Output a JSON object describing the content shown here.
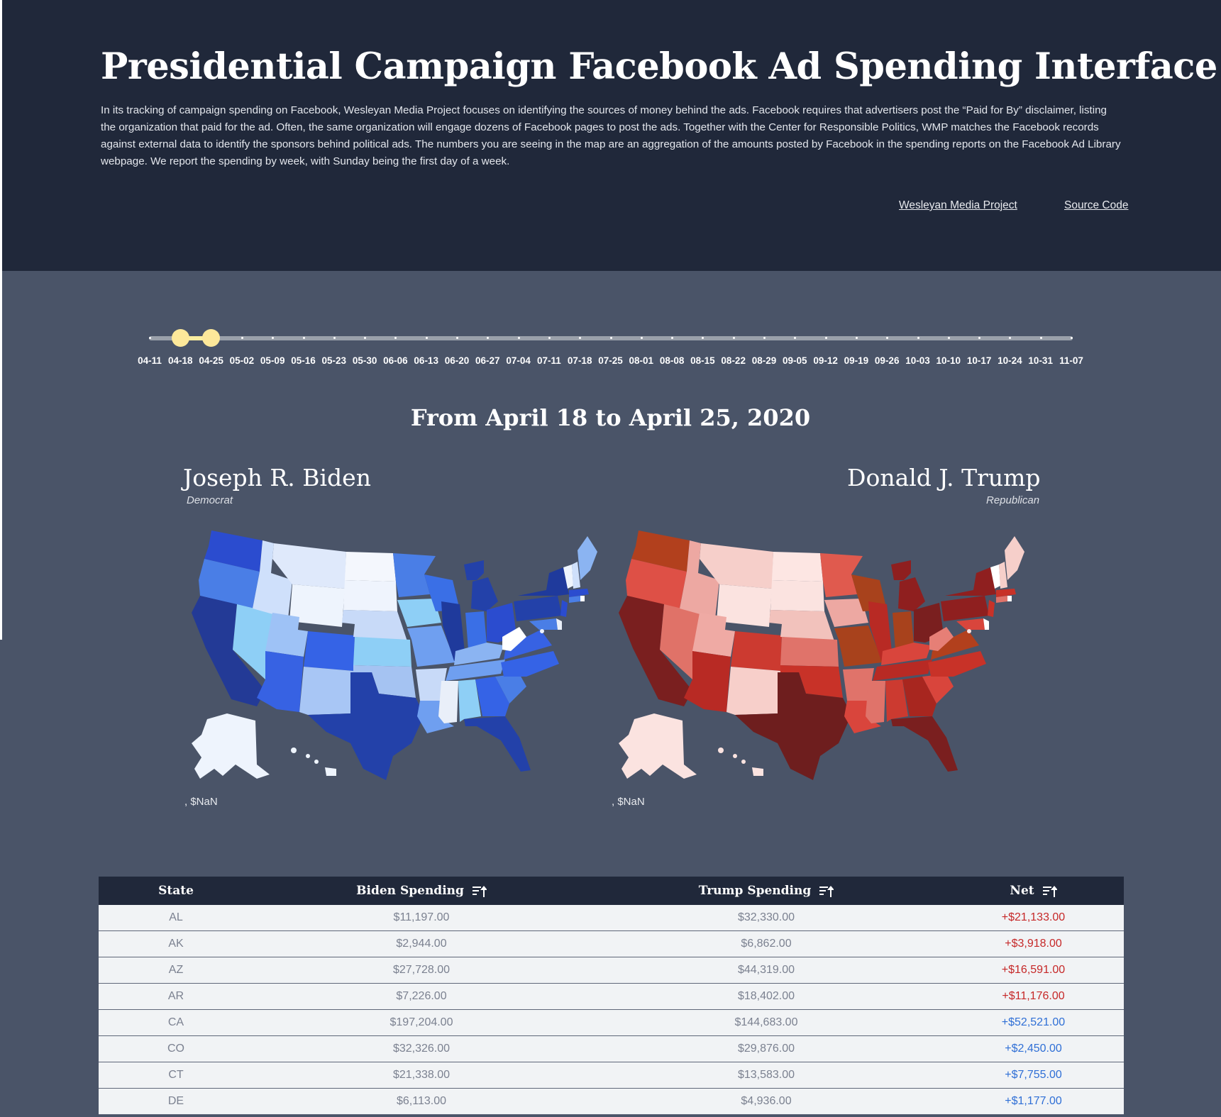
{
  "header": {
    "title": "Presidential Campaign Facebook Ad Spending Interface",
    "description": "In its tracking of campaign spending on Facebook, Wesleyan Media Project focuses on identifying the sources of money behind the ads. Facebook requires that advertisers post the “Paid for By” disclaimer, listing the organization that paid for the ad. Often, the same organization will engage dozens of Facebook pages to post the ads. Together with the Center for Responsible Politics, WMP matches the Facebook records against external data to identify the sponsors behind political ads. The numbers you are seeing in the map are an aggregation of the amounts posted by Facebook in the spending reports on the Facebook Ad Library webpage. We report the spending by week, with Sunday being the first day of a week.",
    "links": [
      "Wesleyan Media Project",
      "Source Code"
    ]
  },
  "slider": {
    "ticks": [
      "04-11",
      "04-18",
      "04-25",
      "05-02",
      "05-09",
      "05-16",
      "05-23",
      "05-30",
      "06-06",
      "06-13",
      "06-20",
      "06-27",
      "07-04",
      "07-11",
      "07-18",
      "07-25",
      "08-01",
      "08-08",
      "08-15",
      "08-22",
      "08-29",
      "09-05",
      "09-12",
      "09-19",
      "09-26",
      "10-03",
      "10-10",
      "10-17",
      "10-24",
      "10-31",
      "11-07"
    ],
    "selected_start": "04-18",
    "selected_end": "04-25",
    "handle_color": "#fde89a"
  },
  "range_title": "From April 18 to April 25, 2020",
  "candidates": {
    "biden": {
      "name": "Joseph R. Biden",
      "party": "Democrat",
      "legend": ", $NaN",
      "color": "#2a46b5"
    },
    "trump": {
      "name": "Donald J. Trump",
      "party": "Republican",
      "legend": ", $NaN",
      "color": "#8e1f1f"
    }
  },
  "table": {
    "headers": [
      "State",
      "Biden Spending",
      "Trump Spending",
      "Net"
    ],
    "sort_icon": "sort-ascending-icon",
    "rows": [
      {
        "state": "AL",
        "biden": "$11,197.00",
        "trump": "$32,330.00",
        "net": "+$21,133.00",
        "favor": "trump"
      },
      {
        "state": "AK",
        "biden": "$2,944.00",
        "trump": "$6,862.00",
        "net": "+$3,918.00",
        "favor": "trump"
      },
      {
        "state": "AZ",
        "biden": "$27,728.00",
        "trump": "$44,319.00",
        "net": "+$16,591.00",
        "favor": "trump"
      },
      {
        "state": "AR",
        "biden": "$7,226.00",
        "trump": "$18,402.00",
        "net": "+$11,176.00",
        "favor": "trump"
      },
      {
        "state": "CA",
        "biden": "$197,204.00",
        "trump": "$144,683.00",
        "net": "+$52,521.00",
        "favor": "biden"
      },
      {
        "state": "CO",
        "biden": "$32,326.00",
        "trump": "$29,876.00",
        "net": "+$2,450.00",
        "favor": "biden"
      },
      {
        "state": "CT",
        "biden": "$21,338.00",
        "trump": "$13,583.00",
        "net": "+$7,755.00",
        "favor": "biden"
      },
      {
        "state": "DE",
        "biden": "$6,113.00",
        "trump": "$4,936.00",
        "net": "+$1,177.00",
        "favor": "biden"
      }
    ]
  }
}
